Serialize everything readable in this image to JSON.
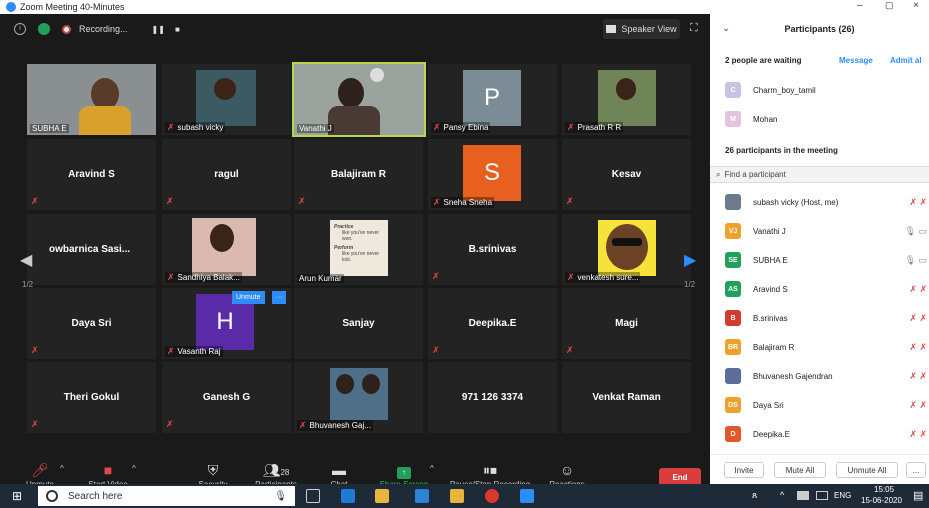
{
  "window": {
    "title": "Zoom Meeting 40-Minutes",
    "min": "–",
    "max": "▢",
    "close": "×"
  },
  "topbar": {
    "recording_label": "Recording...",
    "pause": "❚❚",
    "stop": "■",
    "speaker_view": "Speaker View"
  },
  "tiles": {
    "r1": [
      "SUBHA E",
      "subash vicky",
      "Vanathi J",
      "Pansy Ebina",
      "Prasath R R"
    ],
    "pansy_initial": "P",
    "r2": [
      "Aravind S",
      "ragul",
      "Balajiram R",
      "Sneha Sneha",
      "Kesav"
    ],
    "sneha_initial": "S",
    "r3_name0": "owbarnica  Sasi...",
    "r3_name1": "Sandhiya Balak...",
    "r3_name2": "Arun Kumar",
    "r3_name3": "B.srinivas",
    "r3_name4": "venkatesh sure...",
    "poster": {
      "l1": "Practice",
      "l2": "like you've never won.",
      "l3": "Perform",
      "l4": "like you've never lost."
    },
    "r4": [
      "Daya Sri",
      "Vasanth Raj",
      "Sanjay",
      "Deepika.E",
      "Magi"
    ],
    "vasanth_initial": "H",
    "unmute_popup": "Unmute",
    "more_dots": "···",
    "r5": [
      "Theri Gokul",
      "Ganesh G",
      "Bhuvanesh Gaj...",
      "971 126 3374",
      "Venkat Raman"
    ],
    "page_left": "1/2",
    "page_right": "1/2"
  },
  "toolbar": {
    "unmute": "Unmute",
    "start_video": "Start Video",
    "security": "Security",
    "participants": "Participants",
    "participants_count": "28",
    "chat": "Chat",
    "share_screen": "Share Screen",
    "pause_stop": "Pause/Stop Recording",
    "reactions": "Reactions",
    "end": "End"
  },
  "panel": {
    "title": "Participants (26)",
    "waiting_header": "2 people are waiting",
    "message": "Message",
    "admit_all": "Admit al",
    "waiting": [
      {
        "initial": "C",
        "name": "Charm_boy_tamil",
        "color": "#c9c2e6"
      },
      {
        "initial": "M",
        "name": "Mohan",
        "color": "#e4c2e0"
      }
    ],
    "in_meeting_header": "26 participants in the meeting",
    "search_placeholder": "Find a participant",
    "members": [
      {
        "initial": "",
        "name": "subash vicky (Host, me)",
        "color": "#6b7b8c"
      },
      {
        "initial": "VJ",
        "name": "Vanathi J",
        "color": "#f0a12b"
      },
      {
        "initial": "SE",
        "name": "SUBHA E",
        "color": "#22a05b"
      },
      {
        "initial": "AS",
        "name": "Aravind S",
        "color": "#22a05b"
      },
      {
        "initial": "B",
        "name": "B.srinivas",
        "color": "#d43b2f"
      },
      {
        "initial": "BR",
        "name": "Balajiram R",
        "color": "#f0a12b"
      },
      {
        "initial": "",
        "name": "Bhuvanesh Gajendran",
        "color": "#5d6e9a"
      },
      {
        "initial": "DS",
        "name": "Daya Sri",
        "color": "#f0a12b"
      },
      {
        "initial": "D",
        "name": "Deepika.E",
        "color": "#e2572b"
      }
    ],
    "invite": "Invite",
    "mute_all": "Mute All",
    "unmute_all": "Unmute All",
    "more": "..."
  },
  "taskbar": {
    "search": "Search here",
    "lang": "ENG",
    "time": "15:05",
    "date": "15-06-2020"
  }
}
